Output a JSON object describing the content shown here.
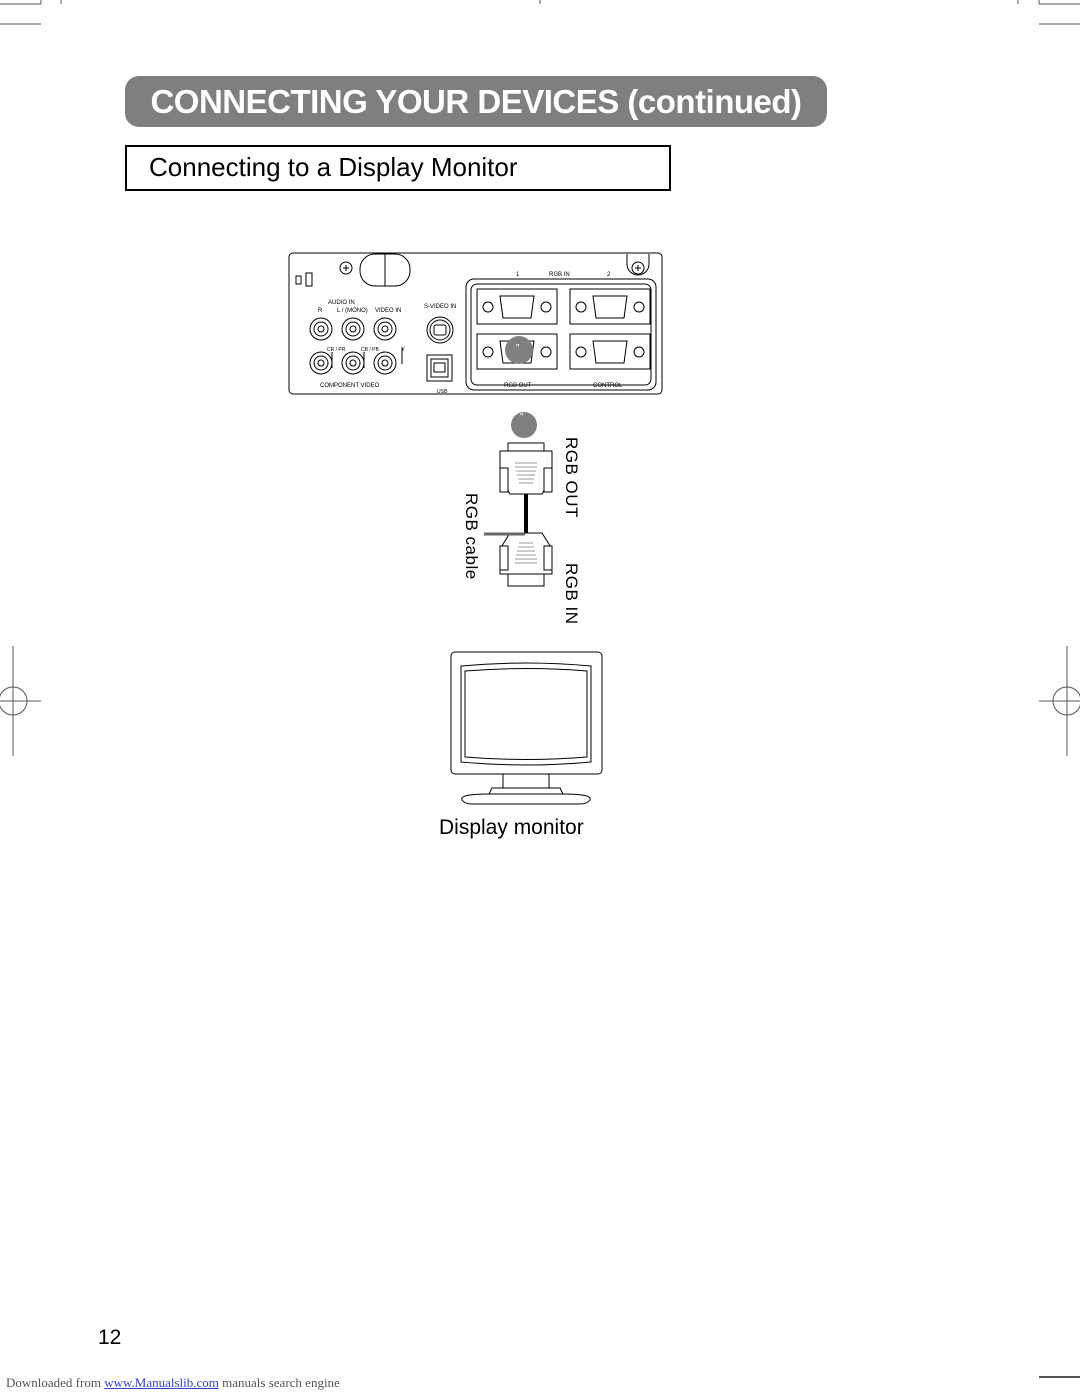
{
  "header": {
    "banner_title": "CONNECTING YOUR DEVICES (continued)",
    "section_title": "Connecting to a Display Monitor"
  },
  "panel": {
    "audio_in": "AUDIO IN",
    "audio_r": "R",
    "audio_l_mono": "L / (MONO)",
    "video_in": "VIDEO IN",
    "s_video_in": "S-VIDEO IN",
    "cr_pr": "CR / PR",
    "cb_pb": "CB / PB",
    "y": "Y",
    "component_video": "COMPONENT  VIDEO",
    "usb": "USB",
    "rgb_in_label": "RGB  IN",
    "rgb_in_1": "1",
    "rgb_in_2": "2",
    "rgb_out": "RGB  OUT",
    "control": "CONTROL",
    "callout_marker": "\""
  },
  "cable": {
    "callout_marker": "\"",
    "rgb_out_label": "RGB OUT",
    "rgb_in_label": "RGB IN",
    "cable_label": "RGB cable"
  },
  "monitor": {
    "caption": "Display monitor"
  },
  "page": {
    "number": "12"
  },
  "footer": {
    "prefix": "Downloaded from ",
    "link_text": "www.Manualslib.com",
    "suffix": "  manuals search engine"
  }
}
